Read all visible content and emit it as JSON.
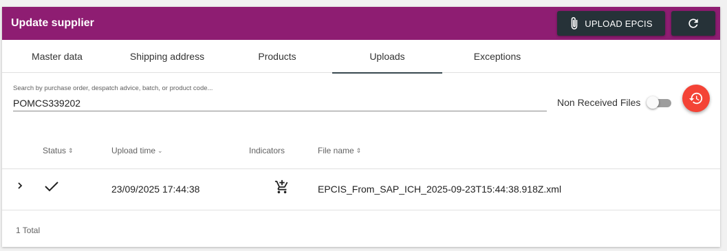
{
  "header": {
    "title": "Update supplier",
    "upload_label": "UPLOAD EPCIS",
    "upload_icon": "paperclip-icon",
    "refresh_icon": "refresh-icon",
    "background_color": "#8e1d72"
  },
  "tabs": [
    {
      "label": "Master data",
      "active": false
    },
    {
      "label": "Shipping address",
      "active": false
    },
    {
      "label": "Products",
      "active": false
    },
    {
      "label": "Uploads",
      "active": true
    },
    {
      "label": "Exceptions",
      "active": false
    }
  ],
  "search": {
    "placeholder": "Search by purchase order, despatch advice, batch, or product code...",
    "value": "POMCS339202"
  },
  "filter": {
    "non_received_label": "Non Received Files",
    "non_received_on": false,
    "history_icon": "history-icon",
    "fab_color": "#f44336"
  },
  "table": {
    "columns": [
      {
        "label": "Status",
        "sort": "⇕"
      },
      {
        "label": "Upload time",
        "sort": "⌄"
      },
      {
        "label": "Indicators",
        "sort": ""
      },
      {
        "label": "File name",
        "sort": "⇕"
      }
    ],
    "rows": [
      {
        "expand_icon": "chevron-right-icon",
        "status_icon": "checkmark-icon",
        "upload_time": "23/09/2025 17:44:38",
        "indicator_icon": "add-shopping-cart-icon",
        "file_name": "EPCIS_From_SAP_ICH_2025-09-23T15:44:38.918Z.xml"
      }
    ],
    "total": "1 Total"
  }
}
